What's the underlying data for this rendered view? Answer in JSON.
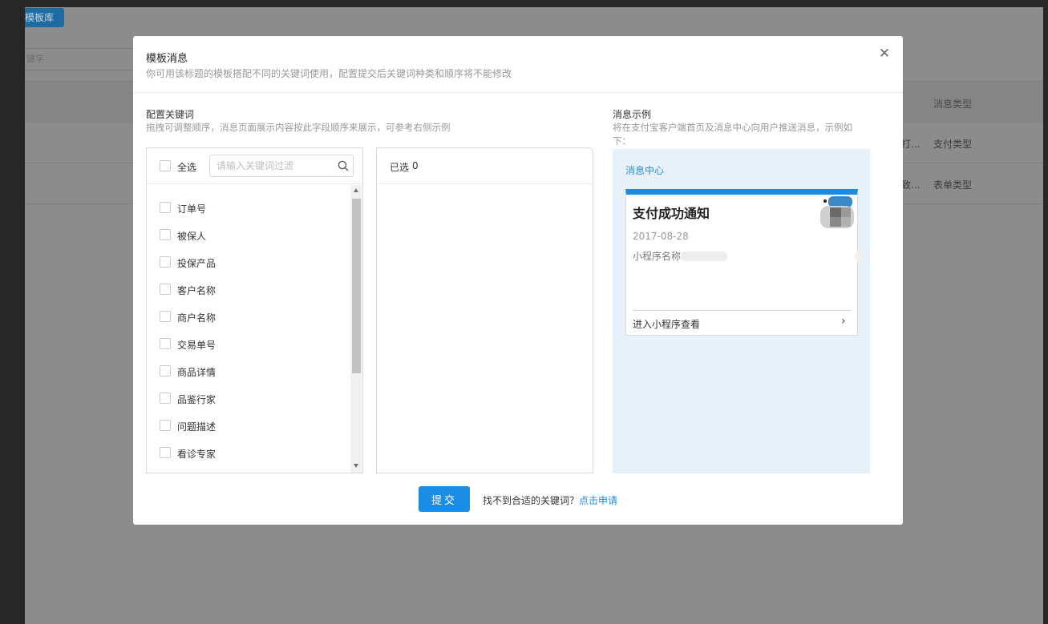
{
  "background": {
    "library_button": "模板库",
    "search_placeholder": "键字",
    "table_header_type": "消息类型",
    "rows": [
      {
        "desc": "打...",
        "type": "支付类型"
      },
      {
        "desc": "致...",
        "type": "表单类型"
      }
    ]
  },
  "modal": {
    "title": "模板消息",
    "subtitle": "你可用该标题的模板搭配不同的关键词使用，配置提交后关键词种类和顺序将不能修改",
    "keywords": {
      "title": "配置关键词",
      "desc": "拖拽可调整顺序，消息页面展示内容按此字段顺序来展示，可参考右侧示例",
      "select_all": "全选",
      "filter_placeholder": "请输入关键词过滤",
      "items": [
        {
          "label": "订单号"
        },
        {
          "label": "被保人"
        },
        {
          "label": "投保产品"
        },
        {
          "label": "客户名称"
        },
        {
          "label": "商户名称"
        },
        {
          "label": "交易单号"
        },
        {
          "label": "商品详情"
        },
        {
          "label": "品鉴行家"
        },
        {
          "label": "问题描述"
        },
        {
          "label": "看诊专家"
        }
      ],
      "selected_label": "已选",
      "selected_count": "0"
    },
    "example": {
      "title": "消息示例",
      "desc": "将在支付宝客户端首页及消息中心向用户推送消息，示例如下：",
      "center_label": "消息中心",
      "card_title": "支付成功通知",
      "card_date": "2017-08-28",
      "card_app_label": "小程序名称",
      "card_enter": "进入小程序查看"
    },
    "submit_label": "提交",
    "help_text": "找不到合适的关键词？",
    "help_link": "点击申请"
  },
  "colors": {
    "primary": "#1a8ce4",
    "overlay": "#8c8c8c",
    "preview_bg": "#e6f1fa"
  }
}
